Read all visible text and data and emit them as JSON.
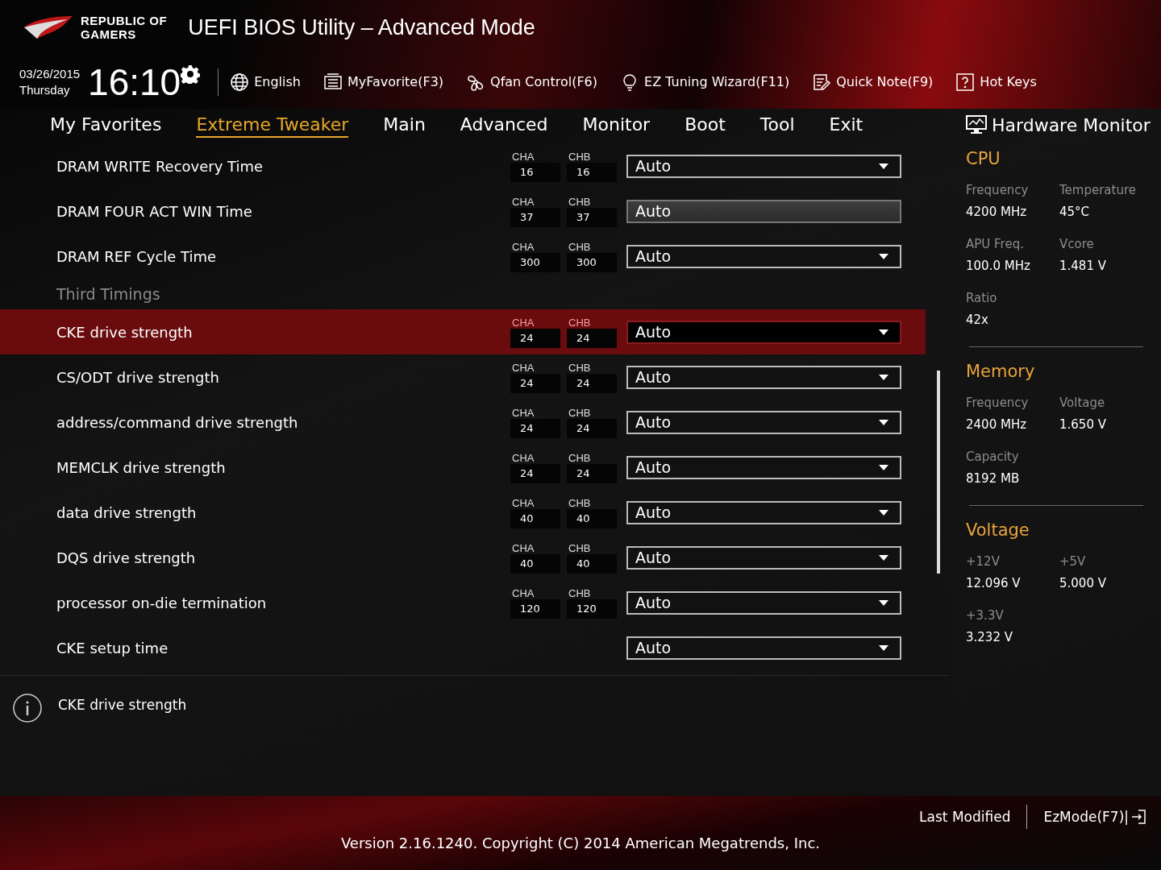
{
  "brand": {
    "line1": "REPUBLIC OF",
    "line2": "GAMERS"
  },
  "window": {
    "title": "UEFI BIOS Utility – Advanced Mode"
  },
  "clock": {
    "date": "03/26/2015",
    "day": "Thursday",
    "time": "16:10"
  },
  "toolbar": [
    {
      "kind": "globe",
      "label": "English"
    },
    {
      "kind": "list",
      "label": "MyFavorite(F3)"
    },
    {
      "kind": "fan",
      "label": "Qfan Control(F6)"
    },
    {
      "kind": "bulb",
      "label": "EZ Tuning Wizard(F11)"
    },
    {
      "kind": "note",
      "label": "Quick Note(F9)"
    },
    {
      "kind": "help",
      "label": "Hot Keys"
    }
  ],
  "tabs": [
    {
      "label": "My Favorites",
      "selected": false
    },
    {
      "label": "Extreme Tweaker",
      "selected": true
    },
    {
      "label": "Main",
      "selected": false
    },
    {
      "label": "Advanced",
      "selected": false
    },
    {
      "label": "Monitor",
      "selected": false
    },
    {
      "label": "Boot",
      "selected": false
    },
    {
      "label": "Tool",
      "selected": false
    },
    {
      "label": "Exit",
      "selected": false
    }
  ],
  "settings": [
    {
      "kind": "setting",
      "label": "DRAM WRITE Recovery Time",
      "cha_label": "CHA",
      "cha": "16",
      "chb_label": "CHB",
      "chb": "16",
      "value": "Auto",
      "selected": false,
      "disabled": false
    },
    {
      "kind": "setting",
      "label": "DRAM FOUR ACT WIN Time",
      "cha_label": "CHA",
      "cha": "37",
      "chb_label": "CHB",
      "chb": "37",
      "value": "Auto",
      "selected": false,
      "disabled": true
    },
    {
      "kind": "setting",
      "label": "DRAM REF Cycle Time",
      "cha_label": "CHA",
      "cha": "300",
      "chb_label": "CHB",
      "chb": "300",
      "value": "Auto",
      "selected": false,
      "disabled": false
    },
    {
      "kind": "section",
      "label": "Third Timings"
    },
    {
      "kind": "setting",
      "label": "CKE drive strength",
      "cha_label": "CHA",
      "cha": "24",
      "chb_label": "CHB",
      "chb": "24",
      "value": "Auto",
      "selected": true,
      "disabled": false
    },
    {
      "kind": "setting",
      "label": "CS/ODT drive strength",
      "cha_label": "CHA",
      "cha": "24",
      "chb_label": "CHB",
      "chb": "24",
      "value": "Auto",
      "selected": false,
      "disabled": false
    },
    {
      "kind": "setting",
      "label": "address/command drive strength",
      "cha_label": "CHA",
      "cha": "24",
      "chb_label": "CHB",
      "chb": "24",
      "value": "Auto",
      "selected": false,
      "disabled": false
    },
    {
      "kind": "setting",
      "label": "MEMCLK drive strength",
      "cha_label": "CHA",
      "cha": "24",
      "chb_label": "CHB",
      "chb": "24",
      "value": "Auto",
      "selected": false,
      "disabled": false
    },
    {
      "kind": "setting",
      "label": "data drive strength",
      "cha_label": "CHA",
      "cha": "40",
      "chb_label": "CHB",
      "chb": "40",
      "value": "Auto",
      "selected": false,
      "disabled": false
    },
    {
      "kind": "setting",
      "label": "DQS drive strength",
      "cha_label": "CHA",
      "cha": "40",
      "chb_label": "CHB",
      "chb": "40",
      "value": "Auto",
      "selected": false,
      "disabled": false
    },
    {
      "kind": "setting",
      "label": "processor on-die termination",
      "cha_label": "CHA",
      "cha": "120",
      "chb_label": "CHB",
      "chb": "120",
      "value": "Auto",
      "selected": false,
      "disabled": false
    },
    {
      "kind": "setting",
      "label": "CKE setup time",
      "value": "Auto",
      "selected": false,
      "disabled": false
    }
  ],
  "help": {
    "text": "CKE drive strength"
  },
  "hardware_monitor": {
    "title": "Hardware Monitor",
    "sections": [
      {
        "title": "CPU",
        "items": [
          {
            "label": "Frequency",
            "value": "4200 MHz"
          },
          {
            "label": "Temperature",
            "value": "45°C"
          },
          {
            "label": "APU Freq.",
            "value": "100.0 MHz"
          },
          {
            "label": "Vcore",
            "value": "1.481 V"
          },
          {
            "label": "Ratio",
            "value": "42x"
          }
        ]
      },
      {
        "title": "Memory",
        "items": [
          {
            "label": "Frequency",
            "value": "2400 MHz"
          },
          {
            "label": "Voltage",
            "value": "1.650 V"
          },
          {
            "label": "Capacity",
            "value": "8192 MB"
          }
        ]
      },
      {
        "title": "Voltage",
        "items": [
          {
            "label": "+12V",
            "value": "12.096 V"
          },
          {
            "label": "+5V",
            "value": "5.000 V"
          },
          {
            "label": "+3.3V",
            "value": "3.232 V"
          }
        ]
      }
    ]
  },
  "footer": {
    "last_modified": "Last Modified",
    "ez_mode": "EzMode(F7)|",
    "version": "Version 2.16.1240. Copyright (C) 2014 American Megatrends, Inc."
  }
}
